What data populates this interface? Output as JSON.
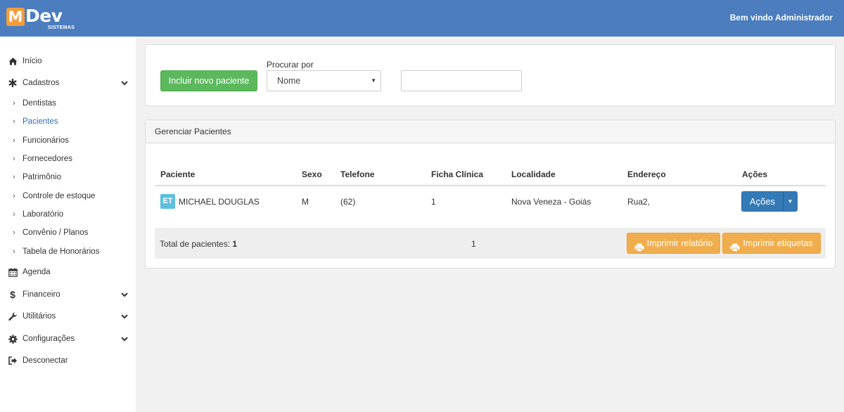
{
  "header": {
    "logo_letter": "M",
    "logo_word": "Dev",
    "logo_sub": "SISTEMAS",
    "welcome": "Bem vindo Administrador",
    "color": "#4b7dbf"
  },
  "sidebar": {
    "items": [
      {
        "label": "Início",
        "icon": "home-icon"
      },
      {
        "label": "Cadastros",
        "icon": "asterisk-icon",
        "expandable": true
      },
      {
        "label": "Agenda",
        "icon": "calendar-icon"
      },
      {
        "label": "Financeiro",
        "icon": "dollar-icon",
        "expandable": true
      },
      {
        "label": "Utilitários",
        "icon": "wrench-icon",
        "expandable": true
      },
      {
        "label": "Configurações",
        "icon": "gear-icon",
        "expandable": true
      },
      {
        "label": "Desconectar",
        "icon": "logout-icon"
      }
    ],
    "subitems": [
      {
        "label": "Dentistas"
      },
      {
        "label": "Pacientes",
        "active": true
      },
      {
        "label": "Funcionários"
      },
      {
        "label": "Fornecedores"
      },
      {
        "label": "Patrimônio"
      },
      {
        "label": "Controle de estoque"
      },
      {
        "label": "Laboratório"
      },
      {
        "label": "Convênio / Planos"
      },
      {
        "label": "Tabela de Honorários"
      }
    ]
  },
  "search_panel": {
    "new_button": "Incluir novo paciente",
    "search_label": "Procurar por",
    "search_by_value": "Nome",
    "search_value": ""
  },
  "manage_panel": {
    "title": "Gerenciar Pacientes",
    "columns": [
      "Paciente",
      "Sexo",
      "Telefone",
      "Ficha Clínica",
      "Localidade",
      "Endereço",
      "Ações"
    ],
    "rows": [
      {
        "avatar": "ET",
        "name": "MICHAEL DOUGLAS",
        "sexo": "M",
        "telefone": "(62)",
        "ficha": "1",
        "localidade": "Nova Veneza - Goiás",
        "endereco": "Rua2,",
        "action_label": "Ações"
      }
    ],
    "total_label": "Total de pacientes:",
    "total_value": "1",
    "page": "1",
    "print_report": "Imprimir relatório",
    "print_labels": "Imprimir etiquetas"
  }
}
